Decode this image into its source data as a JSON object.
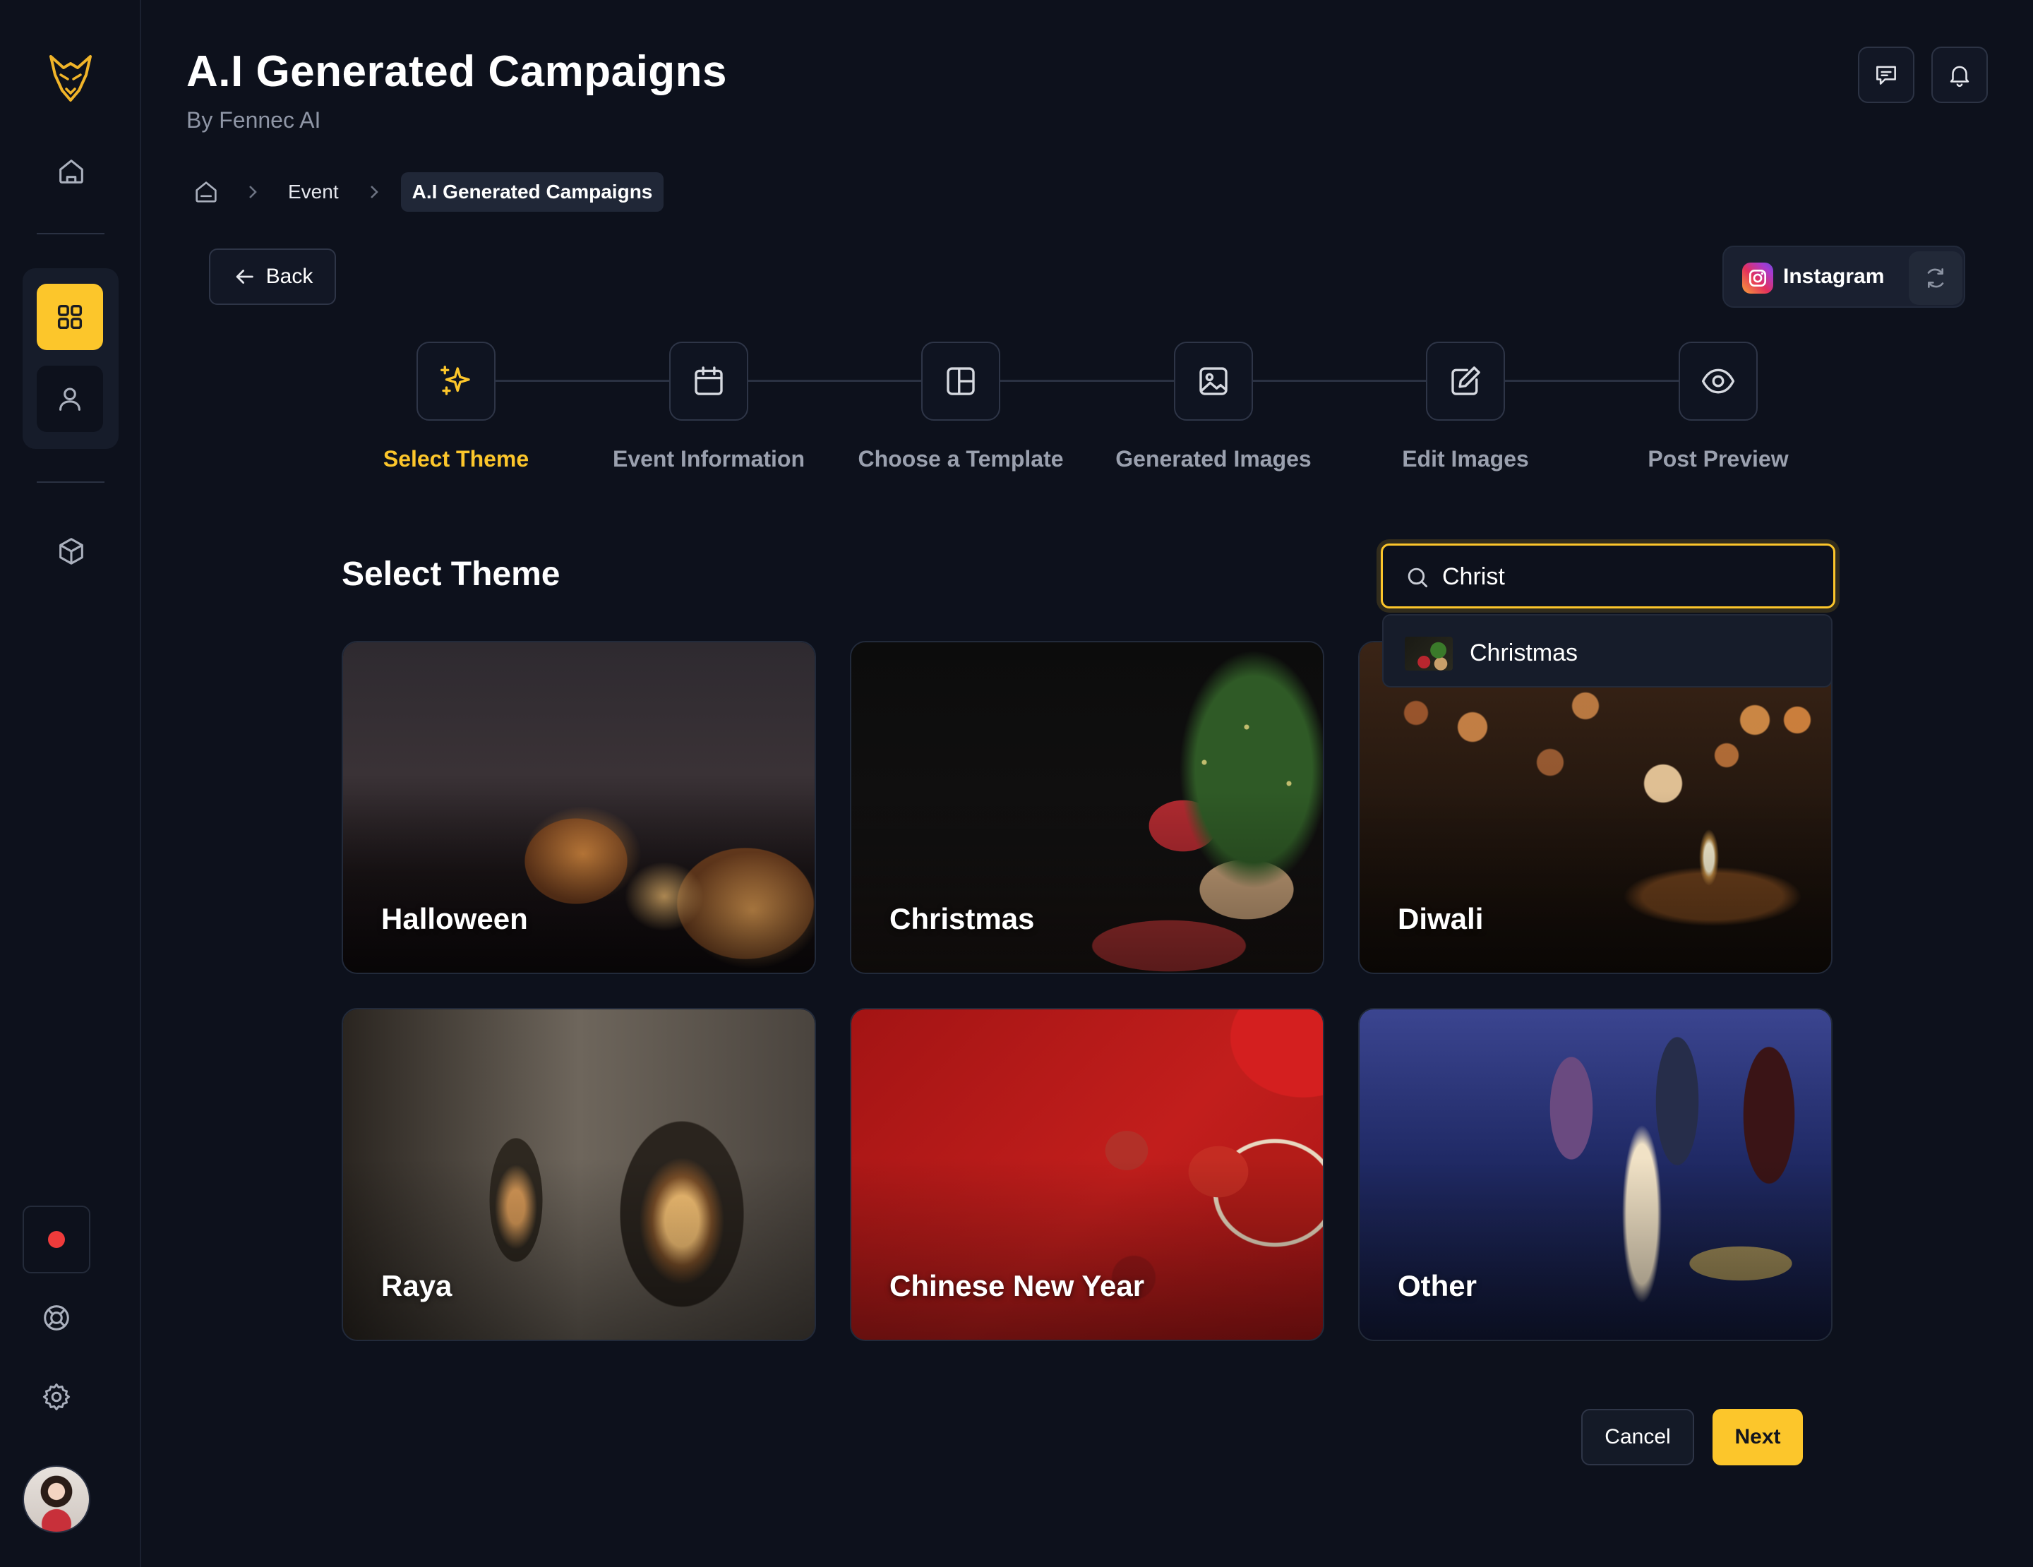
{
  "app": {
    "title": "A.I Generated Campaigns",
    "subtitle": "By Fennec AI"
  },
  "breadcrumb": {
    "items": [
      "Event"
    ],
    "current": "A.I Generated Campaigns"
  },
  "back_label": "Back",
  "platform": {
    "name": "Instagram"
  },
  "stepper": {
    "steps": [
      {
        "label": "Select Theme",
        "icon": "sparkles-icon",
        "active": true
      },
      {
        "label": "Event Information",
        "icon": "calendar-icon",
        "active": false
      },
      {
        "label": "Choose a Template",
        "icon": "layout-icon",
        "active": false
      },
      {
        "label": "Generated Images",
        "icon": "image-icon",
        "active": false
      },
      {
        "label": "Edit Images",
        "icon": "edit-icon",
        "active": false
      },
      {
        "label": "Post Preview",
        "icon": "eye-icon",
        "active": false
      }
    ]
  },
  "section": {
    "title": "Select Theme"
  },
  "search": {
    "value": "Christ",
    "suggestions": [
      "Christmas"
    ]
  },
  "themes": [
    {
      "label": "Halloween"
    },
    {
      "label": "Christmas"
    },
    {
      "label": "Diwali"
    },
    {
      "label": "Raya"
    },
    {
      "label": "Chinese New Year"
    },
    {
      "label": "Other"
    }
  ],
  "footer": {
    "cancel_label": "Cancel",
    "next_label": "Next"
  },
  "colors": {
    "accent": "#fcc62b",
    "background": "#0d111c",
    "record": "#ef3b3b"
  }
}
